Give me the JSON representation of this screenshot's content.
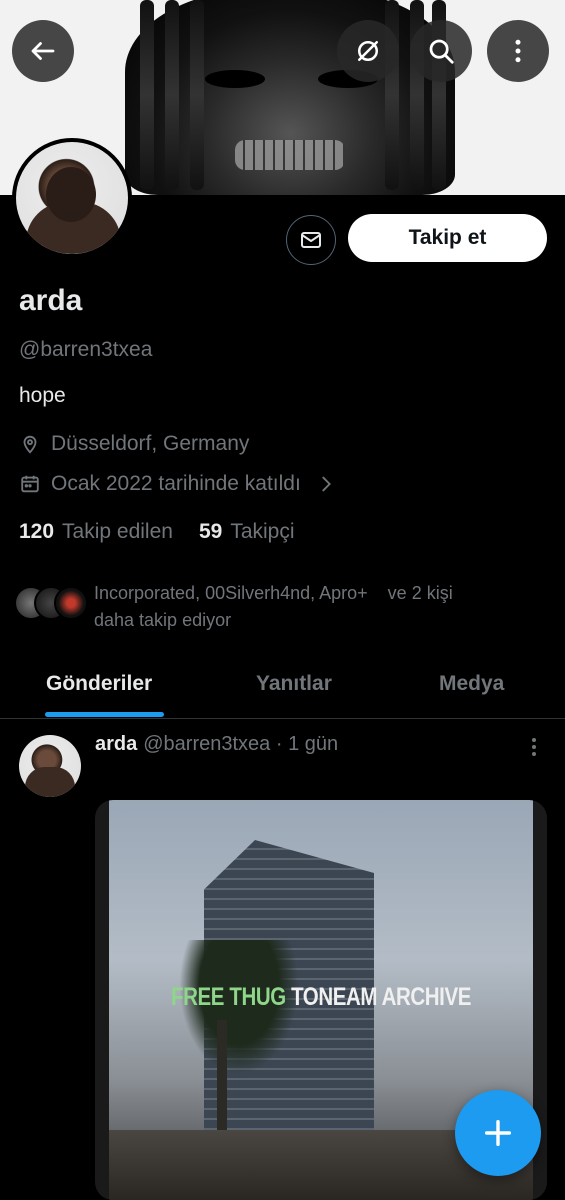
{
  "colors": {
    "accent": "#1d9bf0",
    "background": "#000000",
    "secondary_text": "#71767b"
  },
  "header": {
    "back_icon": "arrow-left-icon",
    "grok_icon": "slashed-circle-icon",
    "search_icon": "search-icon",
    "more_icon": "more-vertical-icon"
  },
  "profile": {
    "name": "arda",
    "handle": "@barren3txea",
    "bio": "hope",
    "location": "Düsseldorf, Germany",
    "joined": "Ocak 2022 tarihinde katıldı",
    "follow_label": "Takip et",
    "message_icon": "mail-icon",
    "following_count": "120",
    "following_label": "Takip edilen",
    "followers_count": "59",
    "followers_label": "Takipçi",
    "known_followers_line1": "Incorporated, 00Silverh4nd, Apro+    ve 2 kişi",
    "known_followers_line2": "daha takip ediyor"
  },
  "tabs": [
    {
      "label": "Gönderiler",
      "active": true
    },
    {
      "label": "Yanıtlar",
      "active": false
    },
    {
      "label": "Medya",
      "active": false
    }
  ],
  "post": {
    "author": "arda",
    "meta": "@barren3txea · 1 gün",
    "media_text_green": "FREE THUG ",
    "media_text_white": "TONEAM ARCHIVE"
  },
  "fab": {
    "icon": "plus-icon"
  }
}
